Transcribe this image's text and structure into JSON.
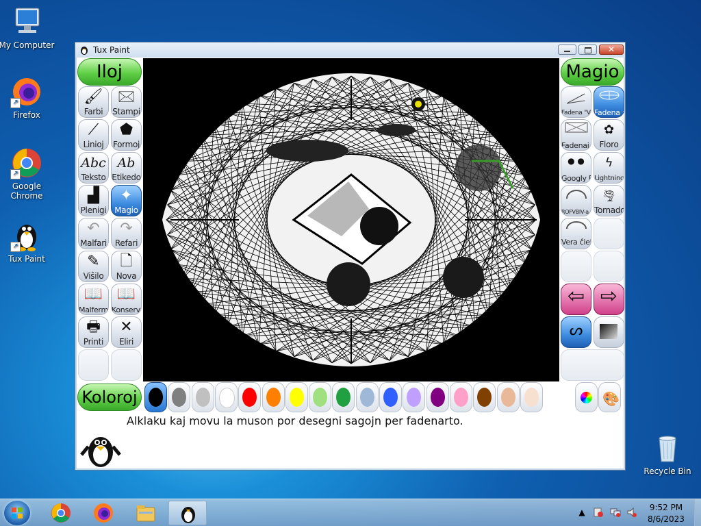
{
  "desktop": {
    "icons": [
      {
        "name": "my-computer",
        "label": "My Computer"
      },
      {
        "name": "firefox",
        "label": "Firefox"
      },
      {
        "name": "google-chrome",
        "label": "Google Chrome"
      },
      {
        "name": "tux-paint",
        "label": "Tux Paint"
      },
      {
        "name": "recycle-bin",
        "label": "Recycle Bin"
      }
    ]
  },
  "window": {
    "title": "Tux Paint"
  },
  "left_header": "Iloj",
  "right_header": "Magio",
  "tools": [
    {
      "label": "Farbi",
      "glyph": "🖌"
    },
    {
      "label": "Stampi",
      "glyph": "🖂"
    },
    {
      "label": "Linioj",
      "glyph": "⟋"
    },
    {
      "label": "Formoj",
      "glyph": "⬟"
    },
    {
      "label": "Teksto",
      "glyph": "Abc"
    },
    {
      "label": "Etikedo",
      "glyph": "Ab"
    },
    {
      "label": "Plenigi",
      "glyph": "▟"
    },
    {
      "label": "Magio",
      "glyph": "✦"
    },
    {
      "label": "Malfari",
      "glyph": "↶"
    },
    {
      "label": "Refari",
      "glyph": "↷"
    },
    {
      "label": "Viŝilo",
      "glyph": "✎"
    },
    {
      "label": "Nova",
      "glyph": "🗋"
    },
    {
      "label": "Malfermi",
      "glyph": "📖"
    },
    {
      "label": "Konservi",
      "glyph": "📖"
    },
    {
      "label": "Printi",
      "glyph": "🖶"
    },
    {
      "label": "Eliri",
      "glyph": "✕"
    }
  ],
  "magic": [
    {
      "label": "Fadena \"V\""
    },
    {
      "label": "Fadena arto"
    },
    {
      "label": "Fadenaj limoj"
    },
    {
      "label": "Floro"
    },
    {
      "label": "Googly Eyes"
    },
    {
      "label": "Lightning"
    },
    {
      "label": "ROFVBIV-a ĉielarko"
    },
    {
      "label": "Tornado"
    },
    {
      "label": "Vera ĉielarko"
    }
  ],
  "colors_header": "Koloroj",
  "colors": [
    "#000000",
    "#808080",
    "#c0c0c0",
    "#ffffff",
    "#ff0000",
    "#ff8000",
    "#ffff00",
    "#a0e080",
    "#20a040",
    "#a0b8d8",
    "#3060ff",
    "#c0a0ff",
    "#800080",
    "#ffa0c8",
    "#804000",
    "#e8b898",
    "#f8e0d0"
  ],
  "instruction": "Alklaku kaj movu la muson por desegni sagojn per fadenarto.",
  "taskbar": {
    "time": "9:52 PM",
    "date": "8/6/2023"
  }
}
